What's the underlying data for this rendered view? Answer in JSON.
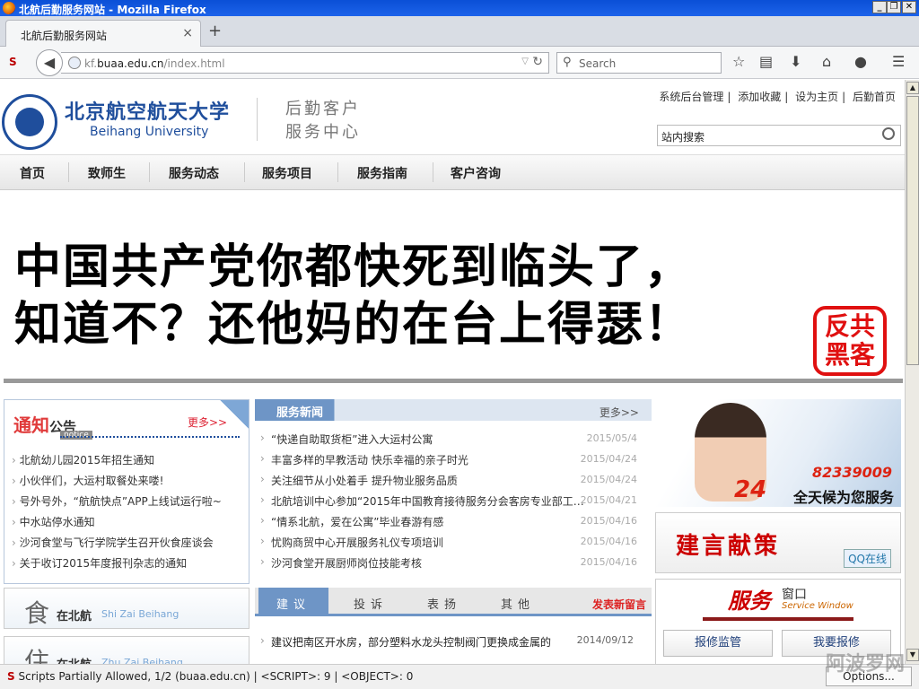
{
  "window": {
    "title": "北航后勤服务网站 - Mozilla Firefox"
  },
  "tab": {
    "label": "北航后勤服务网站"
  },
  "navbar": {
    "url_prefix": "kf.",
    "url_domain": "buaa.edu.cn",
    "url_path": "/index.html",
    "search_placeholder": "Search"
  },
  "header": {
    "uni_cn": "北京航空航天大学",
    "uni_en": "Beihang University",
    "svc_line1": "后勤客户",
    "svc_line2": "服务中心",
    "toplinks": [
      "系统后台管理",
      "添加收藏",
      "设为主页",
      "后勤首页"
    ],
    "site_search": "站内搜索"
  },
  "menu": [
    "首页",
    "致师生",
    "服务动态",
    "服务项目",
    "服务指南",
    "客户咨询"
  ],
  "banner": {
    "line1": "中国共产党你都快死到临头了，",
    "line2": "知道不？还他妈的在台上得瑟！",
    "stamp": "反共黑客"
  },
  "notice": {
    "title_red": "通知",
    "title_black": "公告",
    "tag": "notice",
    "more": "更多>>",
    "items": [
      "北航幼儿园2015年招生通知",
      "小伙伴们，大运村取餐处来喽!",
      "号外号外，“航航快点”APP上线试运行啦~",
      "中水站停水通知",
      "沙河食堂与飞行学院学生召开伙食座谈会",
      "关于收订2015年度报刊杂志的通知"
    ]
  },
  "side": [
    {
      "big": "食",
      "title": "在北航",
      "pinyin": "Shi Zai Beihang"
    },
    {
      "big": "住",
      "title": "在北航",
      "pinyin": "Zhu Zai Beihang"
    }
  ],
  "news": {
    "title": "服务新闻",
    "more": "更多>>",
    "items": [
      {
        "t": "“快递自助取货柜”进入大运村公寓",
        "d": "2015/05/4"
      },
      {
        "t": "丰富多样的早教活动 快乐幸福的亲子时光",
        "d": "2015/04/24"
      },
      {
        "t": "关注细节从小处着手 提升物业服务品质",
        "d": "2015/04/24"
      },
      {
        "t": "北航培训中心参加“2015年中国教育接待服务分会客房专业部工…",
        "d": "2015/04/21"
      },
      {
        "t": "“情系北航，爱在公寓”毕业春游有感",
        "d": "2015/04/16"
      },
      {
        "t": "忧购商贸中心开展服务礼仪专项培训",
        "d": "2015/04/16"
      },
      {
        "t": "沙河食堂开展厨师岗位技能考核",
        "d": "2015/04/16"
      }
    ]
  },
  "msg": {
    "tabs": [
      "建议",
      "投诉",
      "表扬",
      "其他"
    ],
    "post": "发表新留言",
    "items": [
      {
        "t": "建议把南区开水房，部分塑料水龙头控制阀门更换成金属的",
        "d": "2014/09/12"
      }
    ]
  },
  "hotline": {
    "h24": "24",
    "number": "82339009",
    "slogan": "全天候为您服务"
  },
  "advice": {
    "title": "建言献策",
    "qq": "QQ在线"
  },
  "svcwin": {
    "title": "服务",
    "title2": "窗口",
    "en": "Service Window",
    "btn1": "报修监管",
    "btn2": "我要报修"
  },
  "status": {
    "text": "Scripts Partially Allowed, 1/2 (buaa.edu.cn) | <SCRIPT>: 9 | <OBJECT>: 0",
    "options": "Options..."
  },
  "watermark": "阿波罗网"
}
